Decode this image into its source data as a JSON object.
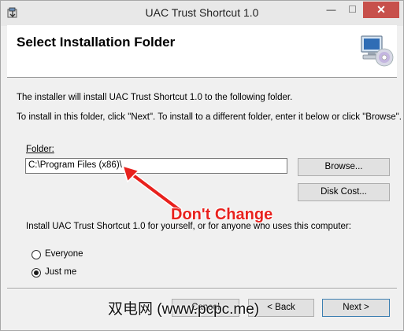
{
  "window": {
    "title": "UAC Trust Shortcut 1.0",
    "minimize_glyph": "—",
    "maximize_glyph": "☐",
    "close_glyph": "✕",
    "app_icon": "installer-icon"
  },
  "header": {
    "title": "Select Installation Folder",
    "icon": "computer-cd-icon"
  },
  "body": {
    "intro": "The installer will install UAC Trust Shortcut 1.0 to the following folder.",
    "instructions": "To install in this folder, click \"Next\". To install to a different folder, enter it below or click \"Browse\".",
    "folder_label": "Folder:",
    "folder_value": "C:\\Program Files (x86)\\",
    "browse_label": "Browse...",
    "disk_cost_label": "Disk Cost...",
    "scope_question": "Install UAC Trust Shortcut 1.0 for yourself, or for anyone who uses this computer:",
    "options": [
      {
        "label": "Everyone",
        "selected": false
      },
      {
        "label": "Just me",
        "selected": true
      }
    ]
  },
  "footer": {
    "cancel_label": "Cancel",
    "back_label": "< Back",
    "next_label": "Next >"
  },
  "annotation": {
    "text": "Don't Change",
    "color": "#e8211d"
  },
  "watermark": "双电网 (www.pcpc.me)"
}
